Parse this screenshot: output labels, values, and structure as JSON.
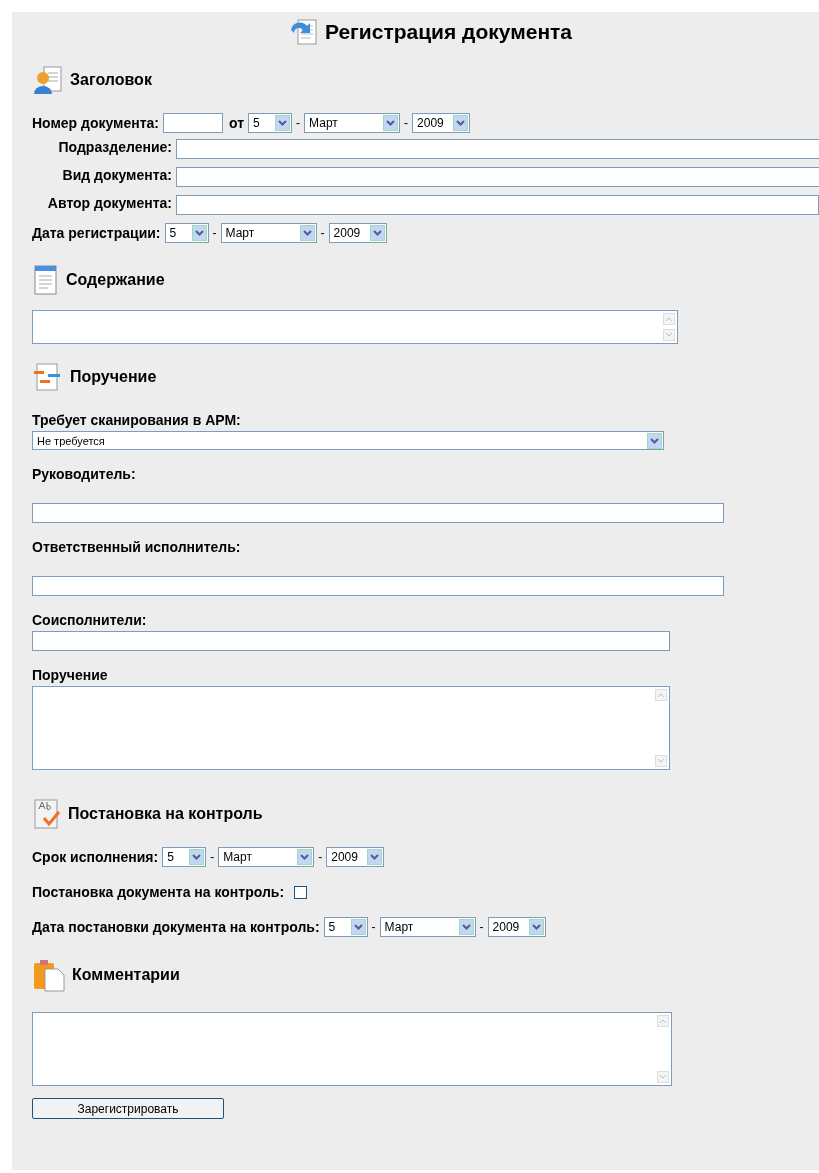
{
  "title": "Регистрация документа",
  "sections": [
    {
      "title": "Заголовок",
      "fields": [
        {
          "kind": "number_date",
          "label": "Номер документа:",
          "connector": "от",
          "date": {
            "day": "5",
            "month": "Март",
            "year": "2009",
            "separators": [
              "-",
              "-"
            ]
          }
        },
        {
          "kind": "inline_text",
          "label": "Подразделение:"
        },
        {
          "kind": "inline_text",
          "label": "Вид документа:"
        },
        {
          "kind": "inline_text",
          "label": "Автор документа:"
        },
        {
          "kind": "date",
          "label": "Дата регистрации:",
          "date": {
            "day": "5",
            "month": "Март",
            "year": "2009",
            "separators": [
              "-",
              "-"
            ]
          }
        }
      ]
    },
    {
      "title": "Содержание",
      "fields": [
        {
          "kind": "textarea"
        }
      ]
    },
    {
      "title": "Поручение",
      "fields": [
        {
          "kind": "select",
          "label": "Требует сканирования в АРМ:",
          "value": "Не требуется"
        },
        {
          "kind": "text",
          "label": "Руководитель:"
        },
        {
          "kind": "text",
          "label": "Ответственный исполнитель:"
        },
        {
          "kind": "text",
          "label": "Соисполнители:"
        },
        {
          "kind": "textarea",
          "label": "Поручение"
        }
      ]
    },
    {
      "title": "Постановка на контроль",
      "fields": [
        {
          "kind": "date",
          "label": "Срок исполнения:",
          "date": {
            "day": "5",
            "month": "Март",
            "year": "2009",
            "separators": [
              "-",
              "-"
            ]
          }
        },
        {
          "kind": "checkbox",
          "label": "Постановка документа на контроль:",
          "checked": false
        },
        {
          "kind": "date",
          "label": "Дата постановки документа на контроль:",
          "date": {
            "day": "5",
            "month": "Март",
            "year": "2009",
            "separators": [
              "-",
              "-"
            ]
          }
        }
      ]
    },
    {
      "title": "Комментарии",
      "fields": [
        {
          "kind": "textarea"
        }
      ]
    }
  ],
  "submit": "Зарегистрировать"
}
